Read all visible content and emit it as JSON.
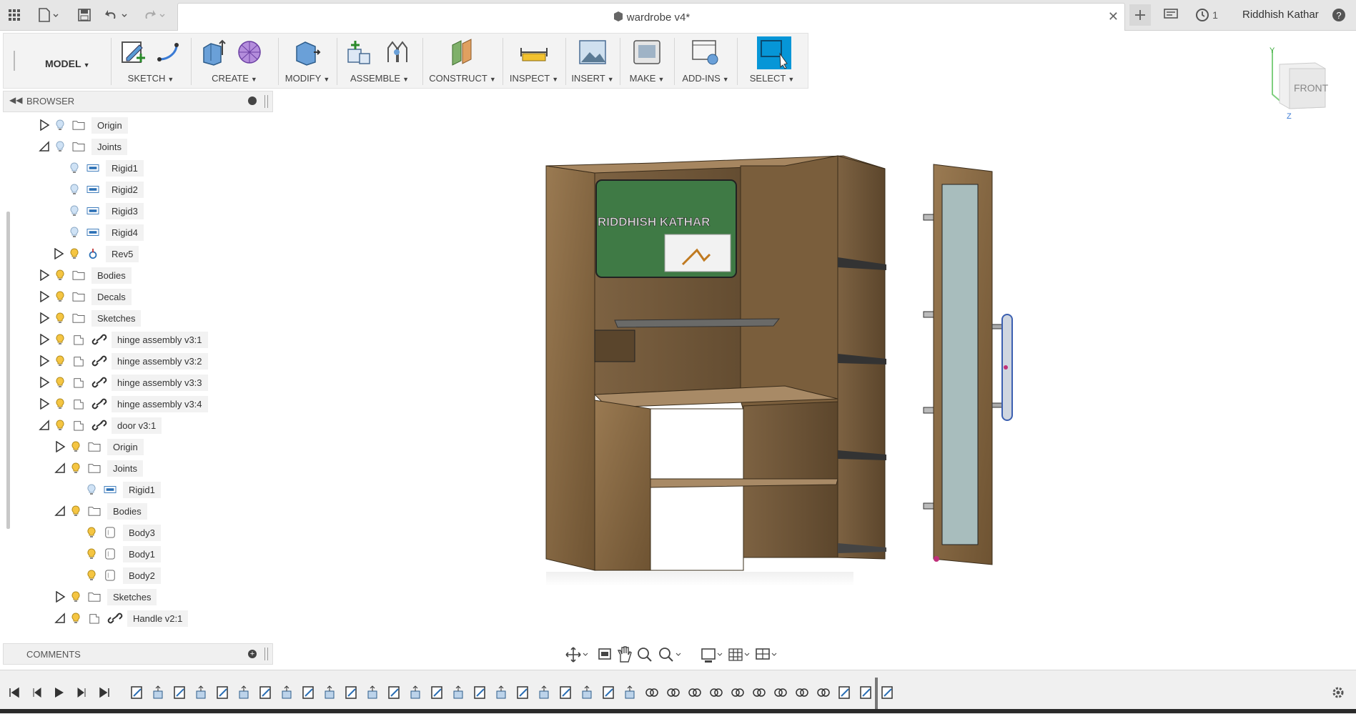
{
  "window": {
    "title": "wardrobe v4*",
    "user": "Riddhish Kathar",
    "notifications": "1"
  },
  "workspace": {
    "mode": "MODEL"
  },
  "ribbon": {
    "groups": [
      {
        "label": "SKETCH"
      },
      {
        "label": "CREATE"
      },
      {
        "label": "MODIFY"
      },
      {
        "label": "ASSEMBLE"
      },
      {
        "label": "CONSTRUCT"
      },
      {
        "label": "INSPECT"
      },
      {
        "label": "INSERT"
      },
      {
        "label": "MAKE"
      },
      {
        "label": "ADD-INS"
      },
      {
        "label": "SELECT"
      }
    ]
  },
  "browser": {
    "title": "BROWSER",
    "items": [
      {
        "label": "Origin",
        "expanded": false
      },
      {
        "label": "Joints",
        "expanded": true
      },
      {
        "label": "Rigid1"
      },
      {
        "label": "Rigid2"
      },
      {
        "label": "Rigid3"
      },
      {
        "label": "Rigid4"
      },
      {
        "label": "Rev5",
        "expanded": false
      },
      {
        "label": "Bodies",
        "expanded": false
      },
      {
        "label": "Decals",
        "expanded": false
      },
      {
        "label": "Sketches",
        "expanded": false
      },
      {
        "label": "hinge assembly v3:1",
        "expanded": false
      },
      {
        "label": "hinge assembly v3:2",
        "expanded": false
      },
      {
        "label": "hinge assembly v3:3",
        "expanded": false
      },
      {
        "label": "hinge assembly v3:4",
        "expanded": false
      },
      {
        "label": "door v3:1",
        "expanded": true
      },
      {
        "label": "Origin",
        "expanded": false
      },
      {
        "label": "Joints",
        "expanded": true
      },
      {
        "label": "Rigid1"
      },
      {
        "label": "Bodies",
        "expanded": true
      },
      {
        "label": "Body3"
      },
      {
        "label": "Body1"
      },
      {
        "label": "Body2"
      },
      {
        "label": "Sketches",
        "expanded": false
      },
      {
        "label": "Handle v2:1",
        "expanded": true
      }
    ]
  },
  "comments": {
    "title": "COMMENTS"
  },
  "viewcube": {
    "face": "FRONT",
    "axes": {
      "y": "Y",
      "z": "Z"
    }
  },
  "model": {
    "decal_text": "RIDDHISH KATHAR"
  },
  "colors": {
    "accent": "#0696d7",
    "select_bg": "#0696d7",
    "wood": "#8a6a44",
    "board": "#3f7a45"
  }
}
